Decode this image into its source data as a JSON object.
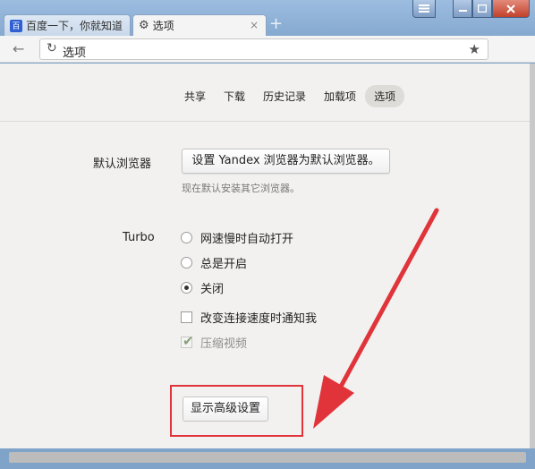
{
  "window": {
    "menu_icon": "hamburger-icon",
    "minimize_icon": "minimize-icon",
    "maximize_icon": "maximize-icon",
    "close_icon": "close-icon"
  },
  "tabs": [
    {
      "label": "百度一下，你就知道",
      "icon": "baidu-paw-icon",
      "icon_text": "百"
    },
    {
      "label": "选项",
      "icon": "gear-icon",
      "close": "×"
    }
  ],
  "new_tab": "+",
  "toolbar": {
    "back_icon": "←",
    "reload_icon": "↻",
    "url": "选项",
    "star_icon": "★"
  },
  "nav": [
    "共享",
    "下载",
    "历史记录",
    "加载项",
    "选项"
  ],
  "nav_active_index": 4,
  "default_browser": {
    "label": "默认浏览器",
    "button": "设置 Yandex 浏览器为默认浏览器。",
    "note": "现在默认安装其它浏览器。"
  },
  "turbo": {
    "label": "Turbo",
    "options": [
      "网速慢时自动打开",
      "总是开启",
      "关闭"
    ],
    "selected_index": 2,
    "notify_label": "改变连接速度时通知我",
    "notify_checked": false,
    "compress_label": "压缩视频",
    "compress_checked": true,
    "compress_disabled": true
  },
  "advanced_button": "显示高级设置",
  "annotation_color": "#e0343a"
}
